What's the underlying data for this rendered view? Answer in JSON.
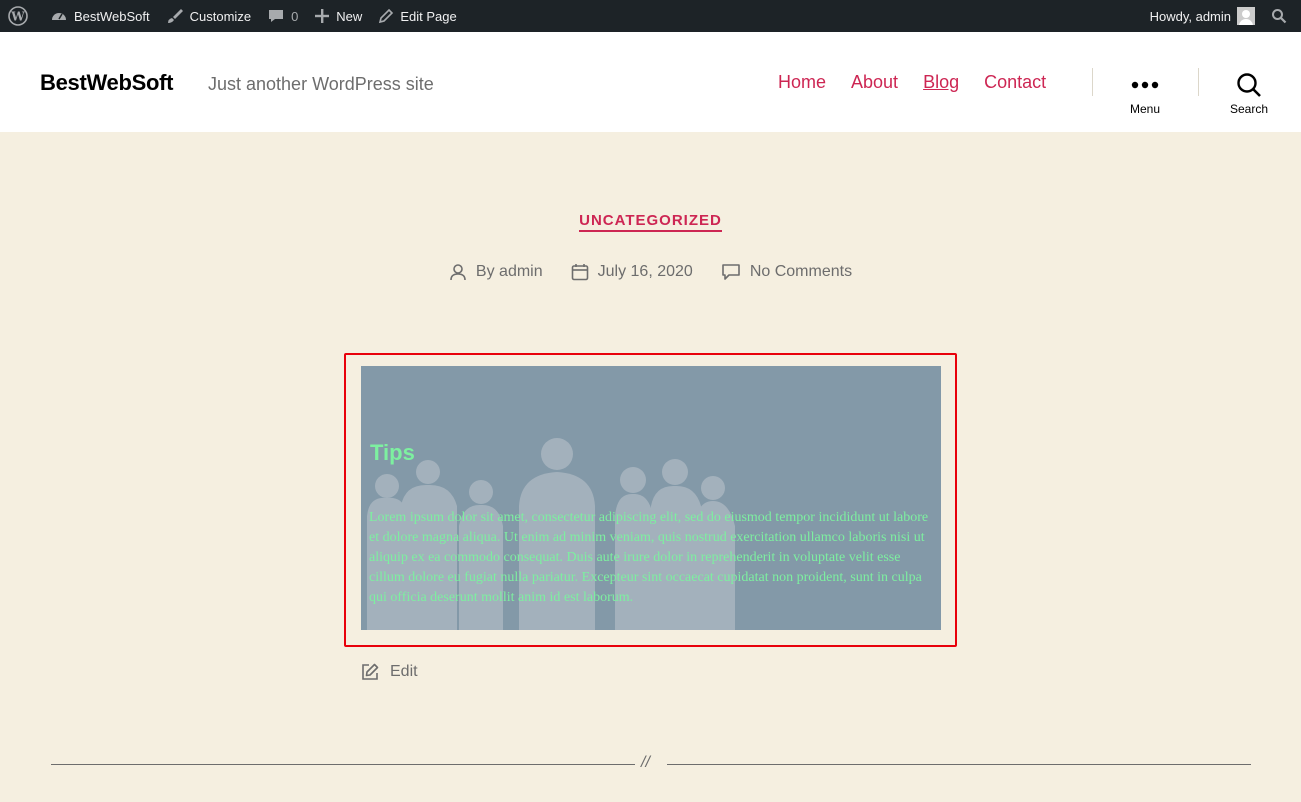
{
  "adminbar": {
    "site_name": "BestWebSoft",
    "customize": "Customize",
    "comments_count": "0",
    "new": "New",
    "edit_page": "Edit Page",
    "howdy": "Howdy, admin"
  },
  "header": {
    "site_title": "BestWebSoft",
    "site_description": "Just another WordPress site",
    "nav": [
      {
        "label": "Home"
      },
      {
        "label": "About"
      },
      {
        "label": "Blog"
      },
      {
        "label": "Contact"
      }
    ],
    "menu_label": "Menu",
    "search_label": "Search"
  },
  "post": {
    "category": "UNCATEGORIZED",
    "author": "By admin",
    "date": "July 16, 2020",
    "comments": "No Comments",
    "cover_title": "Tips",
    "cover_text": "Lorem ipsum dolor sit amet, consectetur adipiscing elit, sed do eiusmod tempor incididunt ut labore et dolore magna aliqua. Ut enim ad minim veniam, quis nostrud exercitation ullamco laboris nisi ut aliquip ex ea commodo consequat. Duis aute irure dolor in reprehenderit in voluptate velit esse cillum dolore eu fugiat nulla pariatur. Excepteur sint occaecat cupidatat non proident, sunt in culpa qui officia deserunt mollit anim id est laborum.",
    "edit_label": "Edit",
    "separator": "//"
  },
  "colors": {
    "accent": "#cd2653",
    "background": "#f5efe0",
    "cover_bg": "#8399a8",
    "cover_text": "#7df0a0",
    "highlight_border": "#e8000b",
    "adminbar_bg": "#1d2327"
  }
}
